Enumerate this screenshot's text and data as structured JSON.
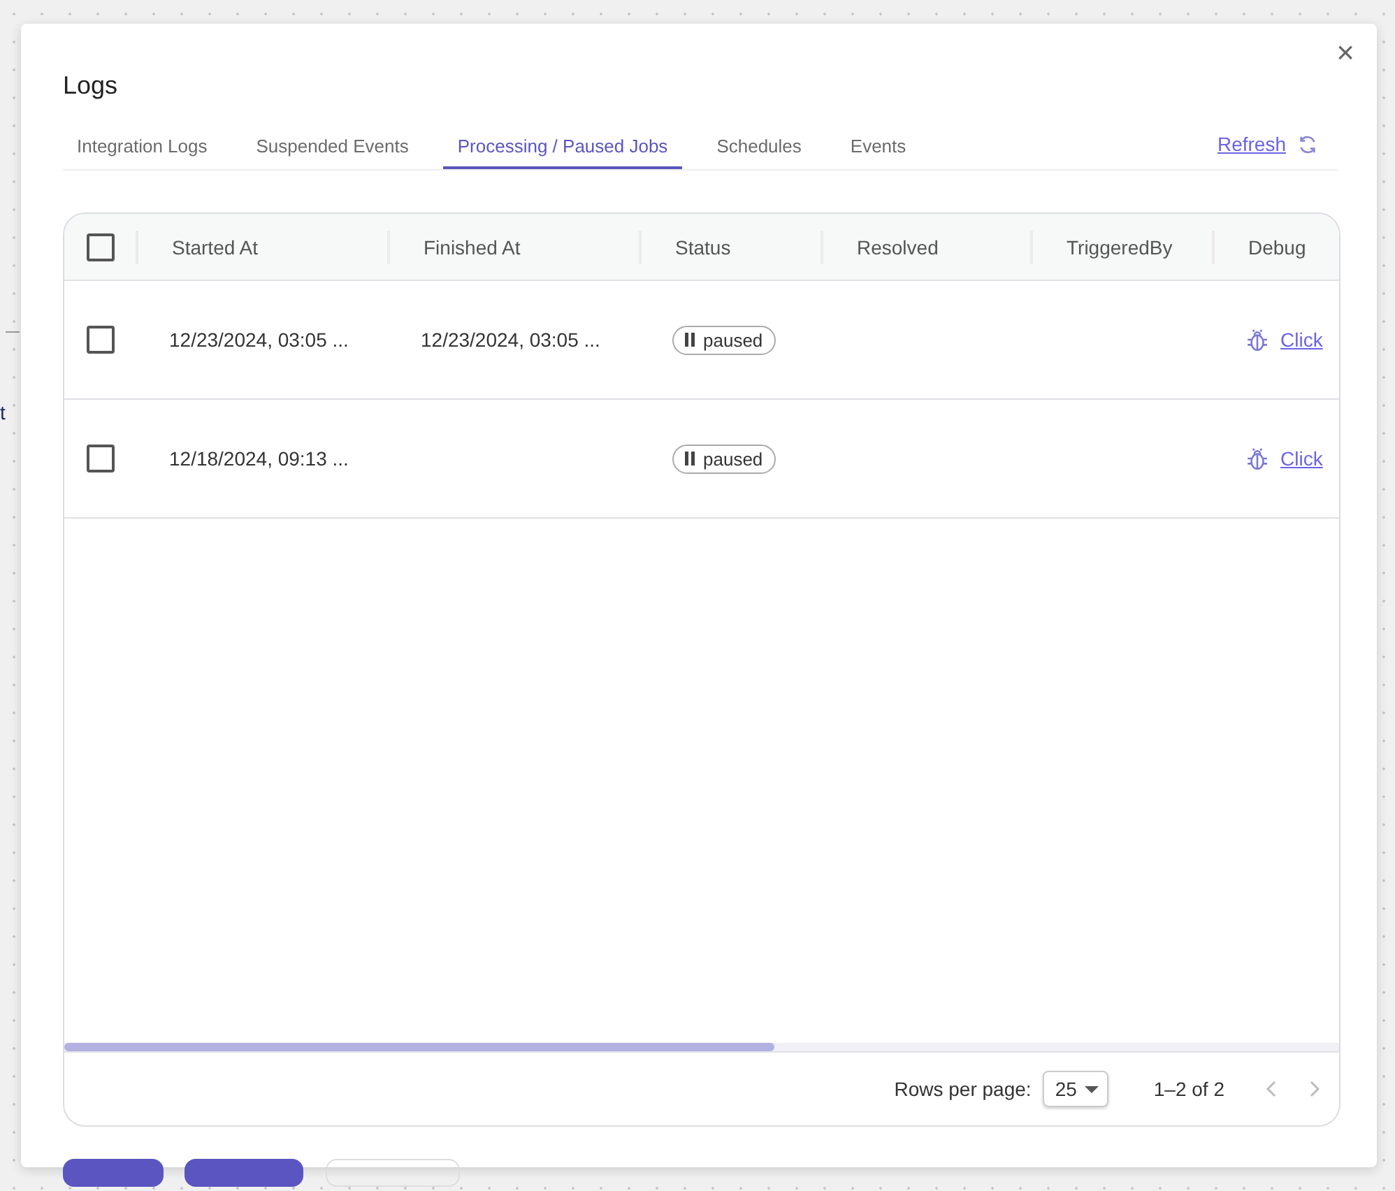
{
  "background_text": "t",
  "dialog": {
    "title": "Logs",
    "close": "×"
  },
  "tabs": [
    {
      "label": "Integration Logs",
      "selected": false
    },
    {
      "label": "Suspended Events",
      "selected": false
    },
    {
      "label": "Processing / Paused Jobs",
      "selected": true
    },
    {
      "label": "Schedules",
      "selected": false
    },
    {
      "label": "Events",
      "selected": false
    }
  ],
  "refresh": "Refresh",
  "table": {
    "header_checked": false,
    "columns": [
      "Started At",
      "Finished At",
      "Status",
      "Resolved",
      "TriggeredBy",
      "Debug"
    ],
    "rows": [
      {
        "checked": false,
        "started_at": "12/23/2024, 03:05 ...",
        "finished_at": "12/23/2024, 03:05 ...",
        "status": "paused",
        "debug": "Click"
      },
      {
        "checked": false,
        "started_at": "12/18/2024, 09:13 ...",
        "status": "paused",
        "debug": "Click"
      }
    ]
  },
  "pagination": {
    "rows_per_page_label": "Rows per page:",
    "rows_per_page": "25",
    "range": "1–2 of 2"
  }
}
